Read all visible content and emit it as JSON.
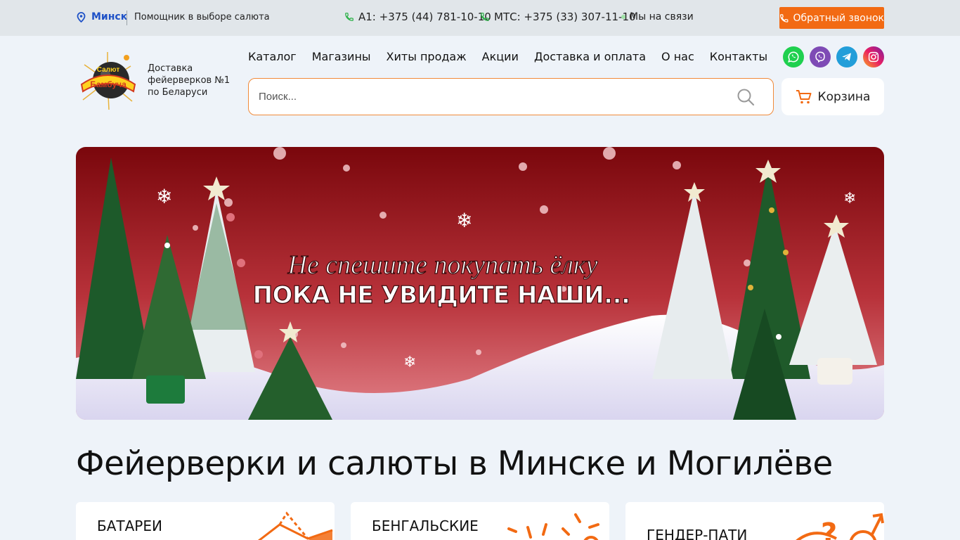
{
  "topbar": {
    "city": "Минск",
    "helper": "Помощник в выборе салюта",
    "phone_a1": "A1: +375 (44) 781-10-10",
    "phone_mts": "МТС: +375 (33) 307-11-10",
    "online": "Мы на связи",
    "callback": "Обратный звонок",
    "accent": "#f26a13",
    "link_color": "#1f52c7"
  },
  "header": {
    "logo_text": "Салют Бамбуча",
    "tagline": "Доставка фейерверков №1 по Беларуси",
    "nav": [
      "Каталог",
      "Магазины",
      "Хиты продаж",
      "Акции",
      "Доставка и оплата",
      "О нас",
      "Контакты"
    ],
    "social": [
      "whatsapp-icon",
      "viber-icon",
      "telegram-icon",
      "instagram-icon"
    ],
    "search_placeholder": "Поиск...",
    "cart_label": "Корзина"
  },
  "banner": {
    "line1": "Не спешите покупать ёлку",
    "line2": "ПОКА НЕ УВИДИТЕ НАШИ..."
  },
  "main": {
    "title": "Фейерверки и салюты в Минске и Могилёве",
    "categories": [
      "БАТАРЕИ",
      "БЕНГАЛЬСКИЕ",
      "ГЕНДЕР-ПАТИ"
    ]
  }
}
